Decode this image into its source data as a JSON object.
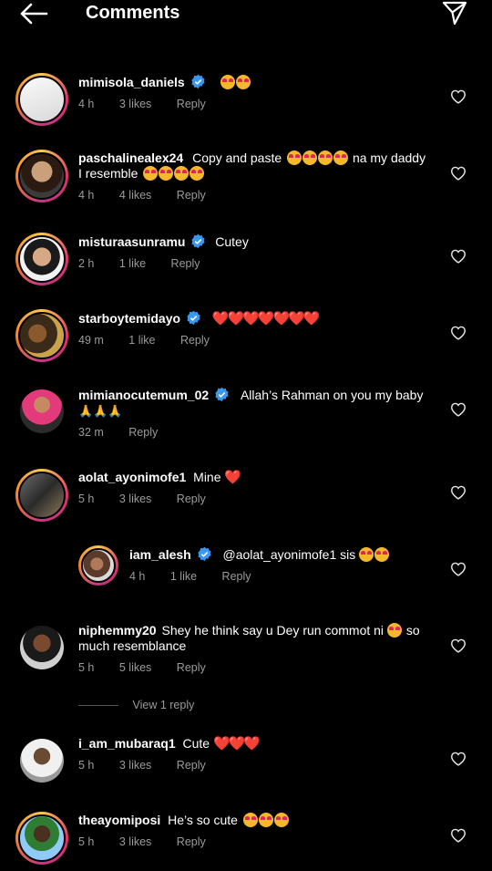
{
  "header": {
    "title": "Comments",
    "back_icon": "arrow-left-icon",
    "share_icon": "paper-plane-icon"
  },
  "colors": {
    "background": "#000000",
    "verified": "#3897f0",
    "story_ring": "#e1306c",
    "meta": "#9a9a9a",
    "heart_emoji": "#e0245e"
  },
  "comments": [
    {
      "username": "mimisola_daniels",
      "verified": true,
      "text": "",
      "emoji": "😍😍",
      "time": "4 h",
      "likes": "3 likes",
      "reply": "Reply"
    },
    {
      "username": "paschalinealex24",
      "verified": false,
      "text_1": "Copy and paste",
      "emoji_1": "😍😍😍😍",
      "text_2": "na my daddy",
      "line2_text": "I resemble",
      "emoji_2": "😍😍😍😍",
      "time": "4 h",
      "likes": "4 likes",
      "reply": "Reply"
    },
    {
      "username": "misturaasunramu",
      "verified": true,
      "text": "Cutey",
      "time": "2 h",
      "likes": "1 like",
      "reply": "Reply"
    },
    {
      "username": "starboytemidayo",
      "verified": true,
      "text": "",
      "emoji": "❤️❤️❤️❤️❤️❤️❤️",
      "time": "49 m",
      "likes": "1 like",
      "reply": "Reply"
    },
    {
      "username": "mimianocutemum_02",
      "verified": true,
      "text": "Allah’s Rahman on you my baby",
      "emoji": "🙏🙏🙏",
      "time": "32 m",
      "likes": "",
      "reply": "Reply"
    },
    {
      "username": "aolat_ayonimofe1",
      "verified": false,
      "text": "Mine",
      "emoji": "❤️",
      "time": "5 h",
      "likes": "3 likes",
      "reply": "Reply"
    },
    {
      "username": "iam_alesh",
      "verified": true,
      "text": "@aolat_ayonimofe1 sis",
      "emoji": "😍😍",
      "time": "4 h",
      "likes": "1 like",
      "reply": "Reply"
    },
    {
      "username": "niphemmy20",
      "verified": false,
      "text": "Shey he think say u Dey run commot ni",
      "emoji": "😄",
      "text_end": "so",
      "line2_text": "much resemblance",
      "time": "5 h",
      "likes": "5 likes",
      "reply": "Reply"
    },
    {
      "username": "i_am_mubaraq1",
      "verified": false,
      "text": "Cute",
      "emoji": "❤️❤️❤️",
      "time": "5 h",
      "likes": "3 likes",
      "reply": "Reply"
    },
    {
      "username": "theayomiposi",
      "verified": false,
      "text": "He’s so cute",
      "emoji": "😍😍😍",
      "time": "5 h",
      "likes": "3 likes",
      "reply": "Reply"
    }
  ],
  "view_replies": "View 1 reply",
  "icons": {
    "like": "heart-outline-icon",
    "verified": "verified-badge-icon"
  }
}
